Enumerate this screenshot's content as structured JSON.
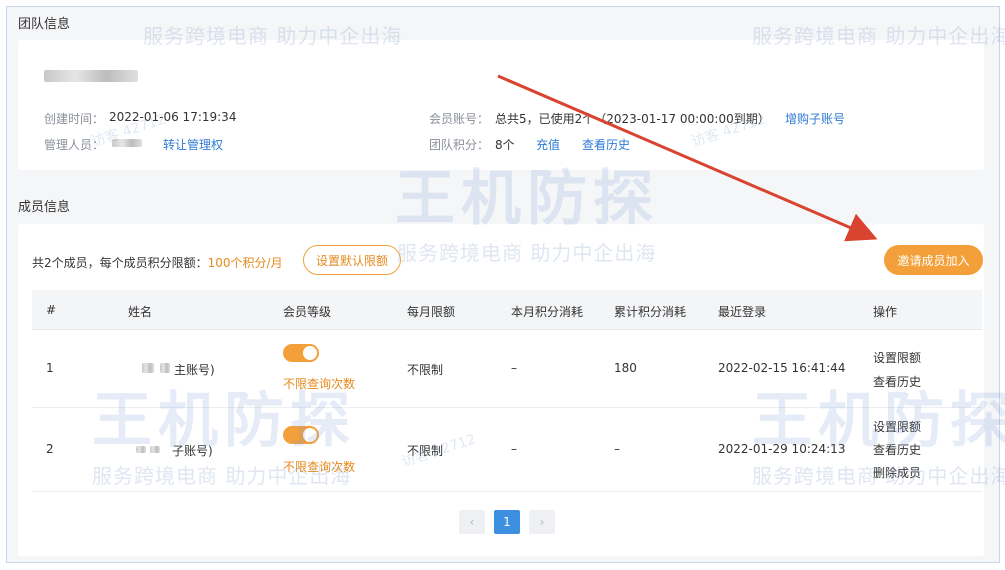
{
  "team": {
    "section_title": "团队信息",
    "create_time_label": "创建时间：",
    "create_time_value": "2022-01-06 17:19:34",
    "admin_label": "管理人员：",
    "transfer_link": "转让管理权",
    "account_label": "会员账号：",
    "account_value": "总共5，已使用2个（2023-01-17 00:00:00到期）",
    "buy_sub_link": "增购子账号",
    "points_label": "团队积分：",
    "points_value": "8个",
    "recharge_link": "充值",
    "history_link": "查看历史"
  },
  "members": {
    "section_title": "成员信息",
    "summary_prefix": "共2个成员，每个成员积分限额：",
    "summary_limit": "100个积分/月",
    "set_default_button": "设置默认限额",
    "invite_button": "邀请成员加入",
    "columns": [
      "#",
      "姓名",
      "会员等级",
      "每月限额",
      "本月积分消耗",
      "累计积分消耗",
      "最近登录",
      "操作"
    ],
    "rows": [
      {
        "index": "1",
        "name_suffix": "主账号)",
        "level_text": "不限查询次数",
        "monthly_limit": "不限制",
        "month_used": "–",
        "total_used": "180",
        "last_login": "2022-02-15 16:41:44",
        "actions": [
          "设置限额",
          "查看历史"
        ]
      },
      {
        "index": "2",
        "name_suffix": "子账号)",
        "level_text": "不限查询次数",
        "monthly_limit": "不限制",
        "month_used": "–",
        "total_used": "–",
        "last_login": "2022-01-29 10:24:13",
        "actions": [
          "设置限额",
          "查看历史",
          "删除成员"
        ]
      }
    ]
  },
  "pagination": {
    "prev": "‹",
    "current": "1",
    "next": "›"
  },
  "watermark": {
    "brand": "王机防探",
    "slogan": "服务跨境电商 助力中企出海",
    "visitor": "访客 42712"
  },
  "colors": {
    "accent_orange": "#f3a03a",
    "link_blue": "#2f7ad6",
    "arrow_red": "#d9432f",
    "page_active": "#3d8fe0"
  }
}
